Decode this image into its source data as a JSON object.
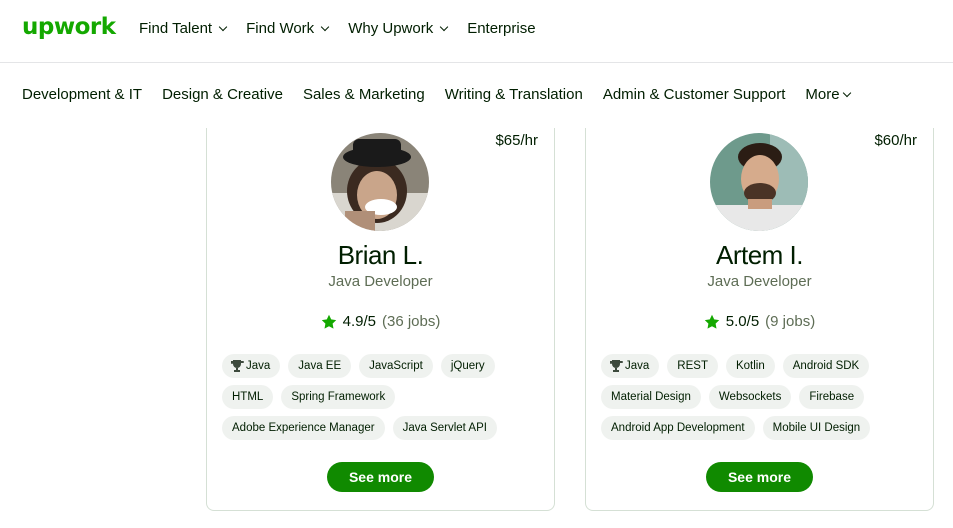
{
  "brand": {
    "logo": "upwork",
    "color": "#14a800"
  },
  "topnav": [
    {
      "label": "Find Talent",
      "dropdown": true
    },
    {
      "label": "Find Work",
      "dropdown": true
    },
    {
      "label": "Why Upwork",
      "dropdown": true
    },
    {
      "label": "Enterprise",
      "dropdown": false
    }
  ],
  "categories": [
    {
      "label": "Development & IT"
    },
    {
      "label": "Design & Creative"
    },
    {
      "label": "Sales & Marketing"
    },
    {
      "label": "Writing & Translation"
    },
    {
      "label": "Admin & Customer Support"
    },
    {
      "label": "More",
      "dropdown": true
    }
  ],
  "freelancers": [
    {
      "name": "Brian L.",
      "title": "Java Developer",
      "rate": "$65/hr",
      "rating": "4.9/5",
      "jobs": "(36 jobs)",
      "skills": [
        "Java",
        "Java EE",
        "JavaScript",
        "jQuery",
        "HTML",
        "Spring Framework",
        "Adobe Experience Manager",
        "Java Servlet API"
      ],
      "cta": "See more"
    },
    {
      "name": "Artem I.",
      "title": "Java Developer",
      "rate": "$60/hr",
      "rating": "5.0/5",
      "jobs": "(9 jobs)",
      "skills": [
        "Java",
        "REST",
        "Kotlin",
        "Android SDK",
        "Material Design",
        "Websockets",
        "Firebase",
        "Android App Development",
        "Mobile UI Design"
      ],
      "cta": "See more"
    }
  ],
  "colors": {
    "star": "#14a800",
    "button": "#108a00",
    "chip": "#eff2ef"
  }
}
